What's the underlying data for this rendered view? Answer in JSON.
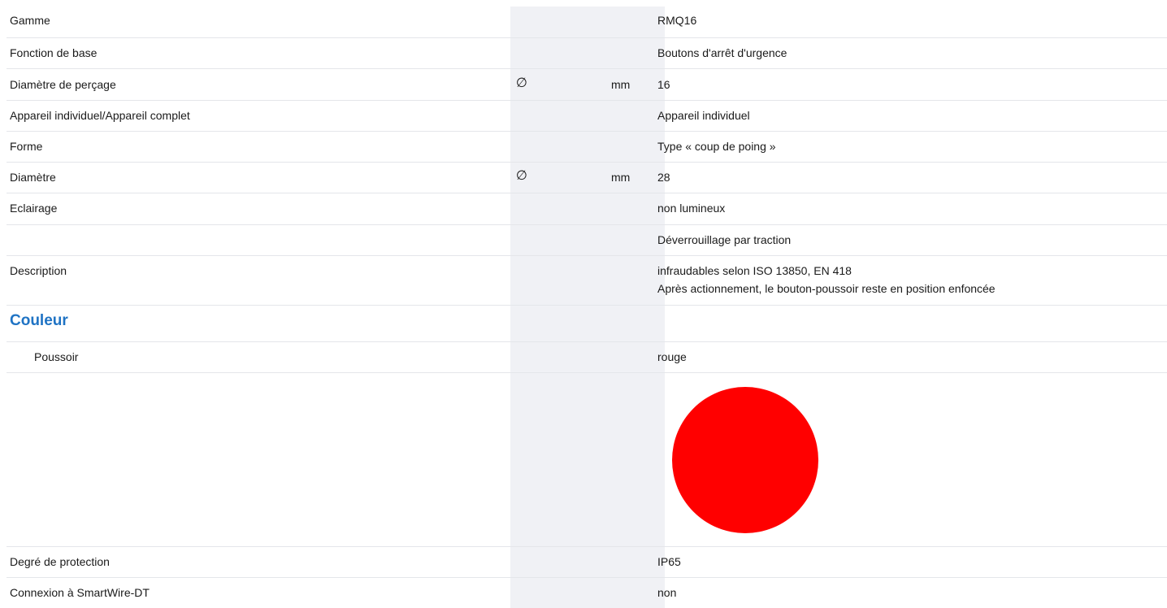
{
  "rows": [
    {
      "label": "Gamme",
      "value": "RMQ16"
    },
    {
      "label": "Fonction de base",
      "value": "Boutons d'arrêt d'urgence"
    },
    {
      "label": "Diamètre de perçage",
      "symbol": "∅",
      "unit": "mm",
      "value": "16"
    },
    {
      "label": "Appareil individuel/Appareil complet",
      "value": "Appareil individuel"
    },
    {
      "label": "Forme",
      "value": "Type « coup de poing »"
    },
    {
      "label": "Diamètre",
      "symbol": "∅",
      "unit": "mm",
      "value": "28"
    },
    {
      "label": "Eclairage",
      "value": "non lumineux"
    },
    {
      "label": "",
      "value": "Déverrouillage par traction"
    },
    {
      "label": "Description",
      "value": "infraudables selon ISO 13850, EN 418",
      "value2": "Après actionnement, le bouton-poussoir reste en position enfoncée"
    }
  ],
  "section": {
    "title": "Couleur"
  },
  "color_rows": [
    {
      "label": "Poussoir",
      "value": "rouge",
      "swatch_color": "#ff0000"
    }
  ],
  "rows_after": [
    {
      "label": "Degré de protection",
      "value": "IP65"
    },
    {
      "label": "Connexion à SmartWire-DT",
      "value": "non"
    }
  ]
}
